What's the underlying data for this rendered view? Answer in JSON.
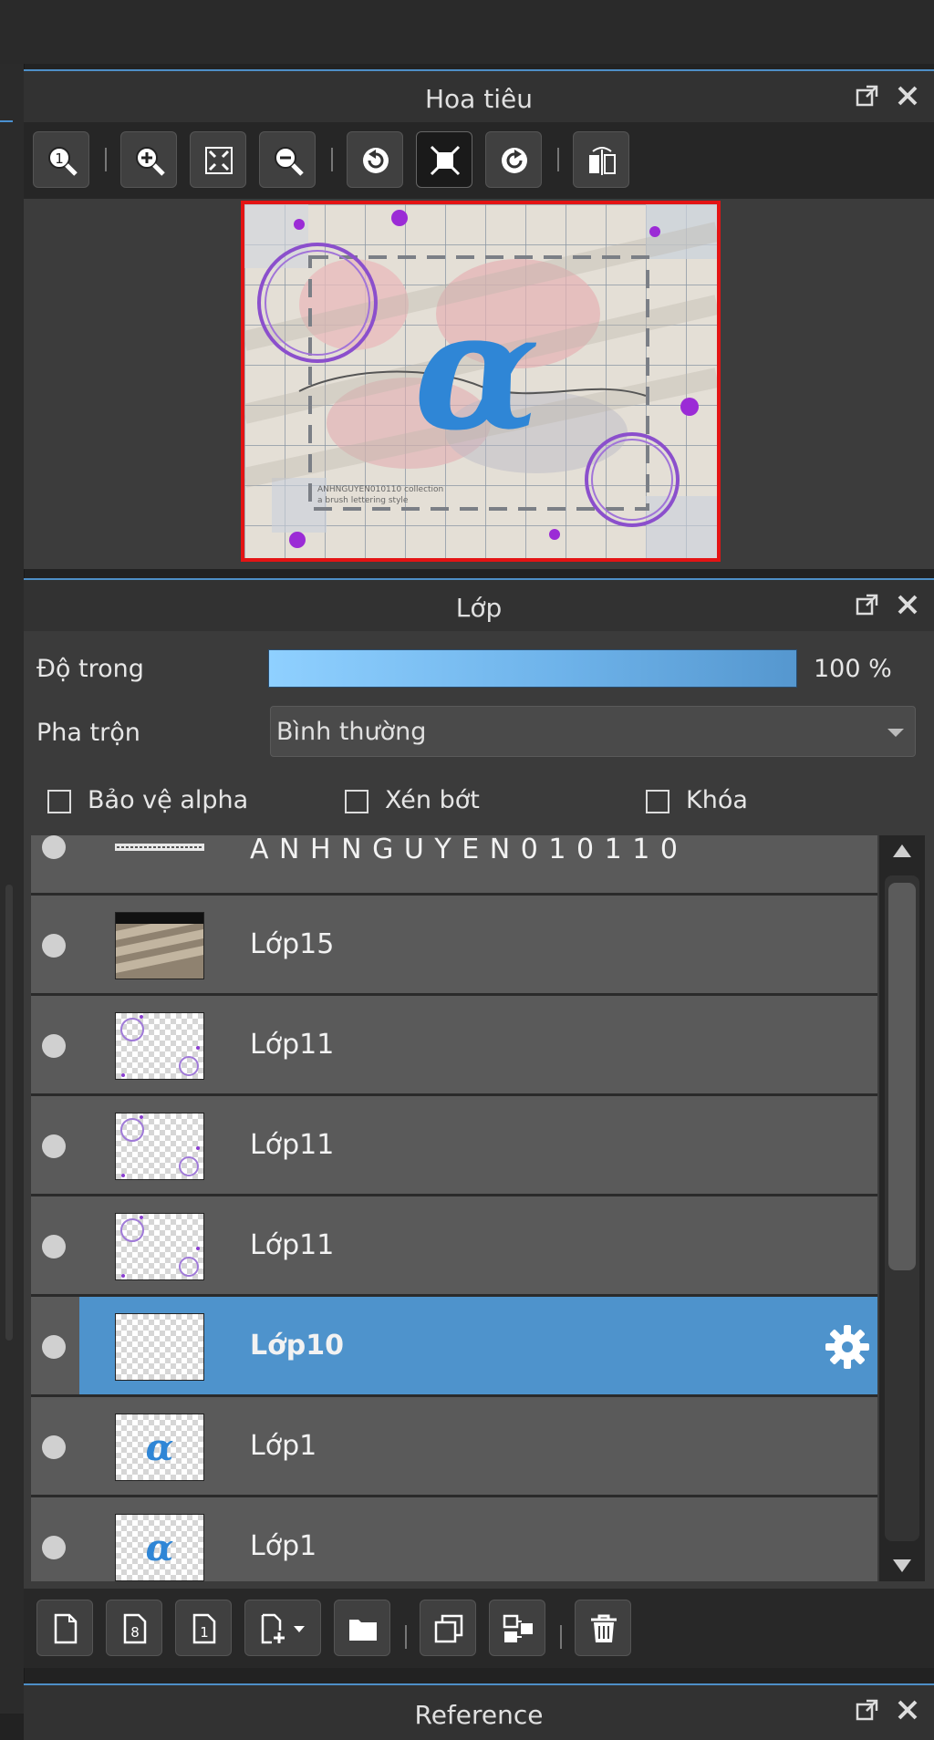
{
  "navigator": {
    "title": "Hoa tiêu",
    "tools": [
      "zoom-actual-icon",
      "zoom-in-icon",
      "fit-screen-icon",
      "zoom-out-icon",
      "rotate-left-icon",
      "fit-canvas-icon",
      "rotate-right-icon",
      "flip-horizontal-icon"
    ],
    "preview": {
      "glyph": "α",
      "watermark_line1": "ANHNGUYEN010110 collection",
      "watermark_line2": "a brush lettering style"
    }
  },
  "layer_panel": {
    "title": "Lớp",
    "opacity_label": "Độ trong",
    "opacity_value": "100 %",
    "opacity_fraction": 1.0,
    "blend_label": "Pha trộn",
    "blend_value": "Bình thường",
    "protect_alpha": "Bảo vệ alpha",
    "clipping": "Xén bớt",
    "lock": "Khóa",
    "selected_color": "#4e93cc",
    "layers": [
      {
        "name": "A N H N G U Y E N 0 1 0 1 1 0",
        "thumb": "text-strip"
      },
      {
        "name": "Lớp15",
        "thumb": "shadow-stripes"
      },
      {
        "name": "Lớp11",
        "thumb": "circles"
      },
      {
        "name": "Lớp11",
        "thumb": "circles"
      },
      {
        "name": "Lớp11",
        "thumb": "circles"
      },
      {
        "name": "Lớp10",
        "thumb": "empty",
        "selected": true
      },
      {
        "name": "Lớp1",
        "thumb": "alpha"
      },
      {
        "name": "Lớp1",
        "thumb": "alpha"
      }
    ],
    "bottom_tools": [
      "new-layer-icon",
      "new-8bit-layer-icon",
      "new-1bit-layer-icon",
      "add-layer-menu-icon",
      "folder-icon",
      "duplicate-layer-icon",
      "merge-down-icon",
      "trash-icon"
    ]
  },
  "reference": {
    "title": "Reference"
  }
}
